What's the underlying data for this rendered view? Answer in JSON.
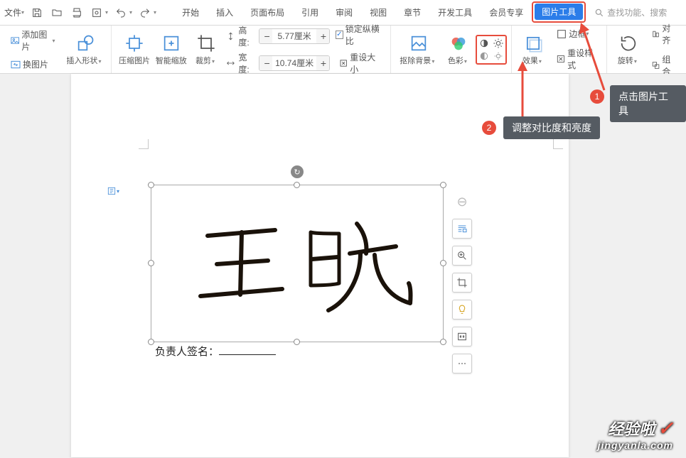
{
  "qa": {
    "file_label": "文件"
  },
  "tabs": {
    "start": "开始",
    "insert": "插入",
    "layout": "页面布局",
    "ref": "引用",
    "review": "审阅",
    "view": "视图",
    "chapter": "章节",
    "dev": "开发工具",
    "member": "会员专享",
    "pic_tools": "图片工具"
  },
  "search": {
    "placeholder": "查找功能、搜索"
  },
  "ribbon": {
    "add_pic": "添加图片",
    "swap_pic": "换图片",
    "insert_shape": "插入形状",
    "compress": "压缩图片",
    "smart_zoom": "智能缩放",
    "crop": "裁剪",
    "height_lbl": "高度:",
    "width_lbl": "宽度:",
    "height_val": "5.77厘米",
    "width_val": "10.74厘米",
    "lock_ratio": "锁定纵横比",
    "reset_size": "重设大小",
    "remove_bg": "抠除背景",
    "color": "色彩",
    "effect": "效果",
    "border": "边框",
    "reset_style": "重设样式",
    "rotate": "旋转",
    "align": "对齐",
    "group": "组合"
  },
  "callouts": {
    "c1": "点击图片工具",
    "c2": "调整对比度和亮度",
    "n1": "1",
    "n2": "2"
  },
  "doc": {
    "sig_label": "负责人签名："
  },
  "float": {
    "minus": "minus-icon",
    "layout": "layout-options-icon",
    "zoom": "zoom-in-icon",
    "crop": "crop-icon",
    "bulb": "lightbulb-icon",
    "chain": "link-icon",
    "more": "more-icon"
  },
  "watermark": {
    "l1": "经验啦",
    "l2": "jingyanla.com"
  }
}
